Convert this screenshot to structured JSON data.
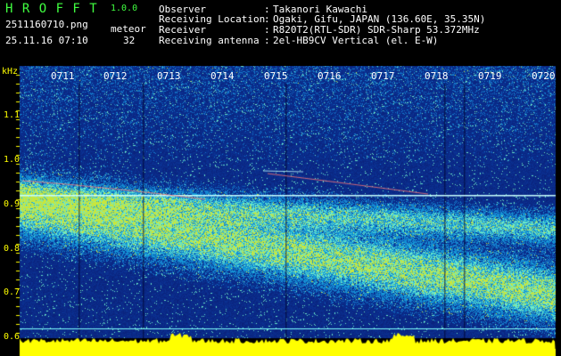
{
  "app": {
    "title": "H R O F F T",
    "version": "1.0.0",
    "filename": "2511160710.png",
    "datetime": "25.11.16 07:10",
    "meteor_label": "meteor",
    "meteor_count": "32"
  },
  "info": [
    {
      "label": "Observer",
      "sep": ":",
      "value": "Takanori Kawachi"
    },
    {
      "label": "Receiving Location",
      "sep": ":",
      "value": "Ogaki, Gifu, JAPAN (136.60E, 35.35N)"
    },
    {
      "label": "Receiver",
      "sep": ":",
      "value": "R820T2(RTL-SDR) SDR-Sharp 53.372MHz"
    },
    {
      "label": "Receiving antenna",
      "sep": ":",
      "value": "2el-HB9CV Vertical (el. E-W)"
    }
  ],
  "spectrogram": {
    "y_unit": "kHz",
    "y_ticks": [
      "1.1",
      "1.0",
      "0.9",
      "0.8",
      "0.7",
      "0.6"
    ],
    "x_ticks": [
      "0711",
      "0712",
      "0713",
      "0714",
      "0715",
      "0716",
      "0717",
      "0718",
      "0719",
      "0720"
    ],
    "carrier_khz": 0.92,
    "colors": {
      "background": "#0a1a6a",
      "axis_text": "#ffff00",
      "carrier": "#c8ffff",
      "histogram": "#ffff00"
    }
  }
}
